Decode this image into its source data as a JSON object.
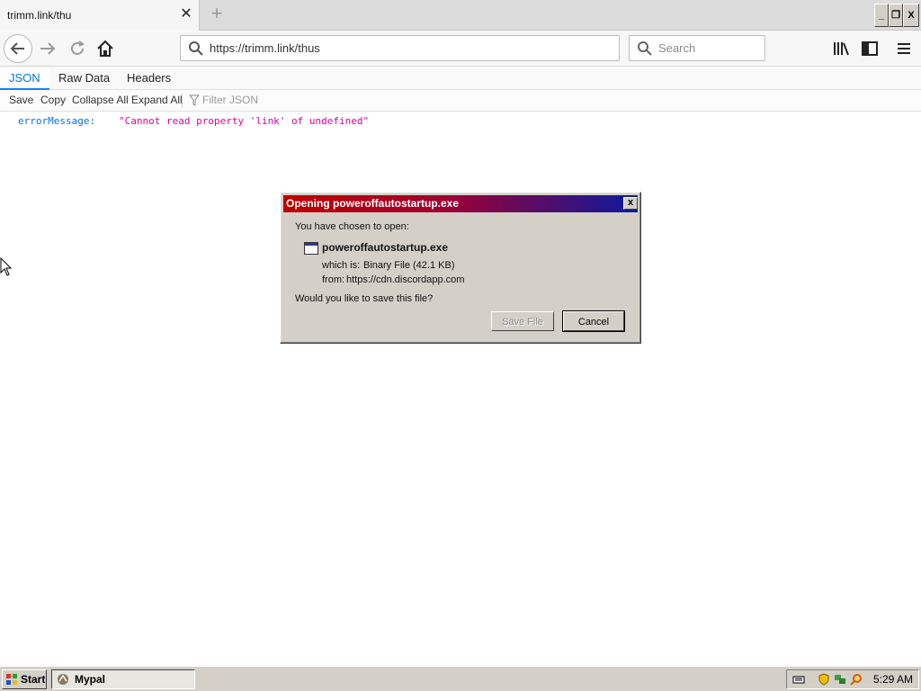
{
  "browser": {
    "tab_title": "trimm.link/thu",
    "tab_close": "✕",
    "new_tab": "+",
    "window_buttons": {
      "minimize": "_",
      "maximize": "❐",
      "close": "X"
    },
    "url": "https://trimm.link/thus",
    "search_placeholder": "Search"
  },
  "viewer": {
    "tabs": {
      "json": "JSON",
      "raw": "Raw Data",
      "headers": "Headers"
    },
    "toolbar": {
      "save": "Save",
      "copy": "Copy",
      "collapse": "Collapse All",
      "expand": "Expand All",
      "filter_placeholder": "Filter JSON"
    },
    "json": {
      "key": "errorMessage:",
      "value": "\"Cannot read property 'link' of undefined\""
    }
  },
  "dialog": {
    "title": "Opening poweroffautostartup.exe",
    "close": "x",
    "chosen": "You have chosen to open:",
    "filename": "poweroffautostartup.exe",
    "which_is_label": "which is:",
    "which_is_value": "Binary File (42.1 KB)",
    "from_label": "from:",
    "from_value": "https://cdn.discordapp.com",
    "question": "Would you like to save this file?",
    "save_button": "Save File",
    "cancel_button": "Cancel"
  },
  "taskbar": {
    "start": "Start",
    "task_item": "Mypal",
    "clock": "5:29 AM"
  }
}
